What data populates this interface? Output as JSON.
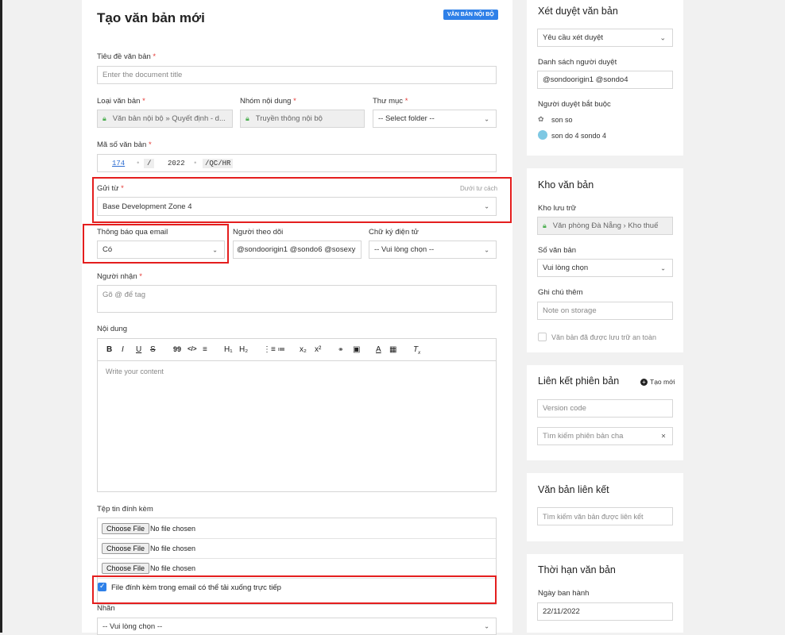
{
  "main": {
    "title": "Tạo văn bản mới",
    "badge": "VĂN BẢN NỘI BỘ",
    "doc_title": {
      "label": "Tiêu đề văn bản",
      "placeholder": "Enter the document title"
    },
    "doc_type": {
      "label": "Loại văn bản",
      "value": "Văn bản nội bộ  »  Quyết định - d..."
    },
    "content_group": {
      "label": "Nhóm nội dung",
      "value": "Truyền thông nội bộ"
    },
    "folder": {
      "label": "Thư mục",
      "value": "-- Select folder --"
    },
    "doc_code": {
      "label": "Mã số văn bản",
      "number": "174",
      "sep": "/",
      "year": "2022",
      "suffix": "/QC/HR"
    },
    "send_from": {
      "label": "Gửi từ",
      "hint": "Dưới tư cách",
      "value": "Base Development Zone 4"
    },
    "email_notify": {
      "label": "Thông báo qua email",
      "value": "Có"
    },
    "followers": {
      "label": "Người theo dõi",
      "value": "@sondoorigin1 @sondo6 @sosexy"
    },
    "e_signature": {
      "label": "Chữ ký điện tử",
      "value": "-- Vui lòng chọn --"
    },
    "recipients": {
      "label": "Người nhận",
      "placeholder": "Gõ @ để tag"
    },
    "content": {
      "label": "Nội dung",
      "placeholder": "Write your content"
    },
    "toolbar": {
      "bold": "B",
      "italic": "I",
      "underline": "U",
      "strike": "S",
      "quote": "99",
      "code": "</>",
      "align": "≡",
      "h1": "H₁",
      "h2": "H₂",
      "ol": "⋮≡",
      "ul": "≔",
      "sub": "x₂",
      "sup": "x²",
      "link": "🔗",
      "image": "▣",
      "color": "A",
      "bg": "▦",
      "clear": "Tx"
    },
    "attachments": {
      "label": "Tệp tin đính kèm",
      "button": "Choose File",
      "status": "No file chosen"
    },
    "attach_checkbox": "File đính kèm trong email có thể tải xuống trực tiếp",
    "labels": {
      "label": "Nhãn",
      "value": "-- Vui lòng chọn --"
    }
  },
  "approval": {
    "title": "Xét duyệt văn bản",
    "select": "Yêu cầu xét duyệt",
    "list_label": "Danh sách người duyệt",
    "list_value": "@sondoorigin1 @sondo4",
    "required_label": "Người duyệt bắt buộc",
    "approvers": [
      "son so",
      "son do 4 sondo 4"
    ]
  },
  "storage": {
    "title": "Kho văn bản",
    "location_label": "Kho lưu trữ",
    "location_value": "Văn phòng Đà Nẵng › Kho thuế",
    "number_label": "Số văn bản",
    "number_value": "Vui lòng chọn",
    "note_label": "Ghi chú thêm",
    "note_placeholder": "Note on storage",
    "stored_checkbox": "Văn bản đã được lưu trữ an toàn"
  },
  "version": {
    "title": "Liên kết phiên bản",
    "new_link": "Tạo mới",
    "code_placeholder": "Version code",
    "parent_placeholder": "Tìm kiếm phiên bản cha"
  },
  "linked": {
    "title": "Văn bản liên kết",
    "search_placeholder": "Tìm kiếm văn bản được liên kết"
  },
  "deadline": {
    "title": "Thời hạn văn bản",
    "issue_label": "Ngày ban hành",
    "issue_value": "22/11/2022"
  }
}
